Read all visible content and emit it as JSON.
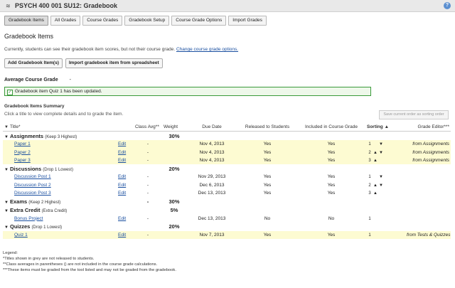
{
  "header": {
    "title": "PSYCH 400 001 SU12: Gradebook",
    "help_icon": "?"
  },
  "tabs": [
    "Gradebook Items",
    "All Grades",
    "Course Grades",
    "Gradebook Setup",
    "Course Grade Options",
    "Import Grades"
  ],
  "page_title": "Gradebook Items",
  "info": {
    "text": "Currently, students can see their gradebook item scores, but not their course grade.",
    "link": "Change course grade options."
  },
  "buttons": {
    "add": "Add Gradebook Item(s)",
    "import": "Import gradebook item from spreadsheet"
  },
  "average": {
    "label": "Average Course Grade",
    "value": "-"
  },
  "message": "Gradebook item Quiz 1 has been updated.",
  "summary": {
    "title": "Gradebook Items Summary",
    "subtitle": "Click a title to view complete details and to grade the item.",
    "save_order": "Save current order as sorting order"
  },
  "columns": {
    "title": "Title*",
    "class_avg": "Class Avg**",
    "weight": "Weight",
    "due": "Due Date",
    "released": "Released to Students",
    "included": "Included in Course Grade",
    "sorting": "Sorting",
    "sort_arrow": "▲",
    "editor": "Grade Editor***"
  },
  "categories": [
    {
      "name": "Assignments",
      "note": "(Keep 3 Highest)",
      "weight": "30%",
      "avg": "",
      "items": [
        {
          "title": "Paper 1",
          "edit": "Edit",
          "avg": "-",
          "due": "Nov 4, 2013",
          "released": "Yes",
          "included": "Yes",
          "sort": "1",
          "up": "",
          "down": "▼",
          "editor": "from Assignments",
          "hl": true,
          "grey": false
        },
        {
          "title": "Paper 2",
          "edit": "Edit",
          "avg": "-",
          "due": "Nov 4, 2013",
          "released": "Yes",
          "included": "Yes",
          "sort": "2",
          "up": "▲",
          "down": "▼",
          "editor": "from Assignments",
          "hl": true,
          "grey": false
        },
        {
          "title": "Paper 3",
          "edit": "Edit",
          "avg": "-",
          "due": "Nov 4, 2013",
          "released": "Yes",
          "included": "Yes",
          "sort": "3",
          "up": "▲",
          "down": "",
          "editor": "from Assignments",
          "hl": true,
          "grey": false
        }
      ]
    },
    {
      "name": "Discussions",
      "note": "(Drop 1 Lowest)",
      "weight": "20%",
      "avg": "",
      "items": [
        {
          "title": "Discussion Post 1",
          "edit": "Edit",
          "avg": "-",
          "due": "Nov 29, 2013",
          "released": "Yes",
          "included": "Yes",
          "sort": "1",
          "up": "",
          "down": "▼",
          "editor": "",
          "hl": false,
          "grey": false
        },
        {
          "title": "Discussion Post 2",
          "edit": "Edit",
          "avg": "-",
          "due": "Dec 6, 2013",
          "released": "Yes",
          "included": "Yes",
          "sort": "2",
          "up": "▲",
          "down": "▼",
          "editor": "",
          "hl": false,
          "grey": false
        },
        {
          "title": "Discussion Post 3",
          "edit": "Edit",
          "avg": "-",
          "due": "Dec 13, 2013",
          "released": "Yes",
          "included": "Yes",
          "sort": "3",
          "up": "▲",
          "down": "",
          "editor": "",
          "hl": false,
          "grey": false
        }
      ]
    },
    {
      "name": "Exams",
      "note": "(Keep 2 Highest)",
      "weight": "30%",
      "avg": "-",
      "items": []
    },
    {
      "name": "Extra Credit",
      "note": "(Extra Credit)",
      "weight": "5%",
      "avg": "",
      "items": [
        {
          "title": "Bonus Project",
          "edit": "Edit",
          "avg": "-",
          "due": "Dec 13, 2013",
          "released": "No",
          "included": "No",
          "sort": "1",
          "up": "",
          "down": "",
          "editor": "",
          "hl": false,
          "grey": true
        }
      ]
    },
    {
      "name": "Quizzes",
      "note": "(Drop 1 Lowest)",
      "weight": "20%",
      "avg": "",
      "items": [
        {
          "title": "Quiz 1",
          "edit": "Edit",
          "avg": "-",
          "due": "Nov 7, 2013",
          "released": "Yes",
          "included": "Yes",
          "sort": "1",
          "up": "",
          "down": "",
          "editor": "from Tests & Quizzes",
          "hl": true,
          "grey": false
        }
      ]
    }
  ],
  "legend": [
    "Legend:",
    "*Titles shown in grey are not released to students.",
    "**Class averages in parentheses () are not included in the course grade calculations.",
    "***These items must be graded from the tool listed and may not be graded from the gradebook."
  ]
}
